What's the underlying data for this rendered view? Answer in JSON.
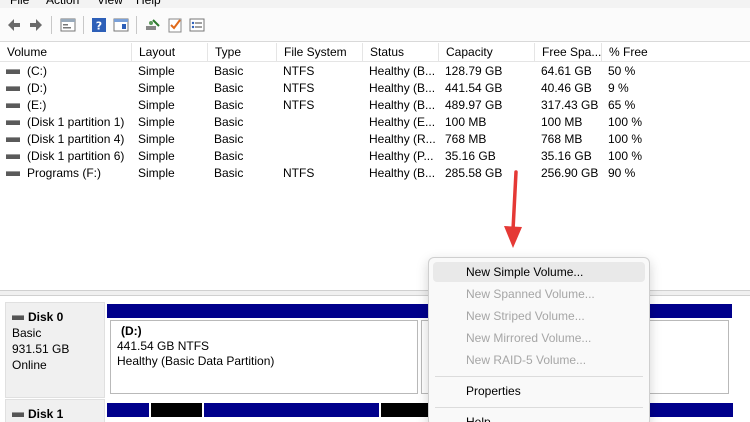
{
  "menu": [
    "File",
    "Action",
    "View",
    "Help"
  ],
  "toolbar": {
    "icons": [
      "back-icon",
      "forward-icon",
      "properties-icon",
      "help-icon",
      "help-window-icon",
      "connect-icon",
      "check-icon",
      "settings-list-icon"
    ]
  },
  "volume_table": {
    "columns": [
      "Volume",
      "Layout",
      "Type",
      "File System",
      "Status",
      "Capacity",
      "Free Spa...",
      "% Free"
    ],
    "rows": [
      {
        "volume": "(C:)",
        "layout": "Simple",
        "type": "Basic",
        "fs": "NTFS",
        "status": "Healthy (B...",
        "capacity": "128.79 GB",
        "free": "64.61 GB",
        "pct": "50 %"
      },
      {
        "volume": "(D:)",
        "layout": "Simple",
        "type": "Basic",
        "fs": "NTFS",
        "status": "Healthy (B...",
        "capacity": "441.54 GB",
        "free": "40.46 GB",
        "pct": "9 %"
      },
      {
        "volume": "(E:)",
        "layout": "Simple",
        "type": "Basic",
        "fs": "NTFS",
        "status": "Healthy (B...",
        "capacity": "489.97 GB",
        "free": "317.43 GB",
        "pct": "65 %"
      },
      {
        "volume": "(Disk 1 partition 1)",
        "layout": "Simple",
        "type": "Basic",
        "fs": "",
        "status": "Healthy (E...",
        "capacity": "100 MB",
        "free": "100 MB",
        "pct": "100 %"
      },
      {
        "volume": "(Disk 1 partition 4)",
        "layout": "Simple",
        "type": "Basic",
        "fs": "",
        "status": "Healthy (R...",
        "capacity": "768 MB",
        "free": "768 MB",
        "pct": "100 %"
      },
      {
        "volume": "(Disk 1 partition 6)",
        "layout": "Simple",
        "type": "Basic",
        "fs": "",
        "status": "Healthy (P...",
        "capacity": "35.16 GB",
        "free": "35.16 GB",
        "pct": "100 %"
      },
      {
        "volume": "Programs (F:)",
        "layout": "Simple",
        "type": "Basic",
        "fs": "NTFS",
        "status": "Healthy (B...",
        "capacity": "285.58 GB",
        "free": "256.90 GB",
        "pct": "90 %"
      }
    ]
  },
  "disks": [
    {
      "name": "Disk 0",
      "type": "Basic",
      "size": "931.51 GB",
      "state": "Online"
    },
    {
      "name": "Disk 1"
    }
  ],
  "disk0_partition": {
    "name": "(D:)",
    "size_fs": "441.54 GB NTFS",
    "status": "Healthy (Basic Data Partition)"
  },
  "context_menu": {
    "items": [
      {
        "label": "New Simple Volume...",
        "enabled": true,
        "highlighted": true
      },
      {
        "label": "New Spanned Volume...",
        "enabled": false
      },
      {
        "label": "New Striped Volume...",
        "enabled": false
      },
      {
        "label": "New Mirrored Volume...",
        "enabled": false
      },
      {
        "label": "New RAID-5 Volume...",
        "enabled": false
      },
      {
        "label": "Properties",
        "enabled": true
      },
      {
        "label": "Help",
        "enabled": true
      }
    ]
  },
  "colors": {
    "partition_bar": "#00008b",
    "annotation_arrow": "#e53935",
    "highlight": "#e9e9e9",
    "disabled_text": "#a6a6a6"
  }
}
